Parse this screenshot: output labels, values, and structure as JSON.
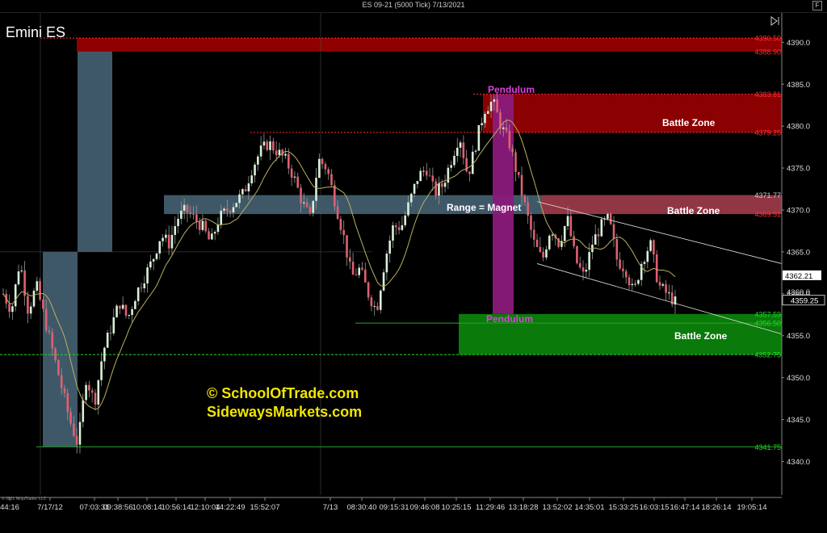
{
  "window": {
    "title": "ES 09-21 (5000 Tick)  7/13/2021",
    "button": "F"
  },
  "colors": {
    "bull": "#d8f0d8",
    "bear": "#e06070",
    "wick": "#999999",
    "ma": "#b8b060",
    "bg": "#000000",
    "resistance": "#8b0000",
    "support": "#0a7a0a",
    "magnet": "#3f5868",
    "pendulum": "#8a1a7a",
    "watermark": "#f2e600"
  },
  "chart_data": {
    "type": "candlestick",
    "title": "Emini ES",
    "ylim": [
      4336.0,
      4393.5
    ],
    "y_ticks": [
      4340.0,
      4345.0,
      4350.0,
      4355.0,
      4360.0,
      4365.0,
      4370.0,
      4375.0,
      4380.0,
      4385.0,
      4390.0
    ],
    "x_tick_labels": [
      "44:16",
      "7/17/12",
      "07:03:31",
      "09:38:56",
      "10:08:14",
      "10:56:14",
      "12:10:04",
      "14:22:49",
      "15:52:07",
      "7/13",
      "08:30:40",
      "09:15:31",
      "09:46:08",
      "10:25:15",
      "11:29:46",
      "13:18:28",
      "13:52:02",
      "14:35:01",
      "15:33:25",
      "16:03:15",
      "16:47:14",
      "18:26:14",
      "19:05:14"
    ],
    "price_levels": [
      {
        "value": 4390.5,
        "label": "4390.50",
        "color": "#ff3030"
      },
      {
        "value": 4388.9,
        "label": "4388.90",
        "color": "#ff3030"
      },
      {
        "value": 4383.81,
        "label": "4383.81",
        "color": "#ff3030"
      },
      {
        "value": 4379.25,
        "label": "4379.25",
        "color": "#ff3030"
      },
      {
        "value": 4371.77,
        "label": "4371.77",
        "color": "#cccccc"
      },
      {
        "value": 4369.51,
        "label": "4369.51",
        "color": "#ff3030"
      },
      {
        "value": 4357.59,
        "label": "4357.59",
        "color": "#22dd22"
      },
      {
        "value": 4356.5,
        "label": "4356.50",
        "color": "#22dd22"
      },
      {
        "value": 4352.75,
        "label": "4352.75",
        "color": "#22dd22"
      },
      {
        "value": 4341.75,
        "label": "4341.75",
        "color": "#22dd22"
      }
    ],
    "price_markers": [
      {
        "value": 4362.21,
        "label": "4362.21",
        "style": "black-on-white"
      },
      {
        "value": 4360.0,
        "label": "4360.0",
        "style": "partial"
      },
      {
        "value": 4359.25,
        "label": "4359.25",
        "style": "white-on-black"
      }
    ],
    "annotations": {
      "battle_zone_top": "Battle Zone",
      "battle_zone_mid": "Battle Zone",
      "battle_zone_bottom": "Battle Zone",
      "range_magnet": "Range = Magnet",
      "pendulum_top": "Pendulum",
      "pendulum_bottom": "Pendulum",
      "watermark_line1": "© SchoolOfTrade.com",
      "watermark_line2": "SidewaysMarkets.com",
      "copyright": "© 2021 NinjaTrader, LLC"
    },
    "anchors": [
      [
        0,
        4360
      ],
      [
        6,
        4358
      ],
      [
        12,
        4364
      ],
      [
        18,
        4358
      ],
      [
        24,
        4361
      ],
      [
        30,
        4357
      ],
      [
        36,
        4353
      ],
      [
        42,
        4349
      ],
      [
        48,
        4345
      ],
      [
        54,
        4342
      ],
      [
        60,
        4350
      ],
      [
        66,
        4347
      ],
      [
        72,
        4353
      ],
      [
        78,
        4356
      ],
      [
        84,
        4359
      ],
      [
        90,
        4357
      ],
      [
        96,
        4360
      ],
      [
        102,
        4362
      ],
      [
        108,
        4364
      ],
      [
        114,
        4367
      ],
      [
        120,
        4366
      ],
      [
        126,
        4369
      ],
      [
        132,
        4370
      ],
      [
        138,
        4369
      ],
      [
        144,
        4368
      ],
      [
        150,
        4366
      ],
      [
        156,
        4369
      ],
      [
        162,
        4370
      ],
      [
        168,
        4371
      ],
      [
        174,
        4372
      ],
      [
        180,
        4375
      ],
      [
        186,
        4377
      ],
      [
        192,
        4378
      ],
      [
        198,
        4377
      ],
      [
        204,
        4376
      ],
      [
        210,
        4374
      ],
      [
        216,
        4371
      ],
      [
        222,
        4369
      ],
      [
        228,
        4376
      ],
      [
        234,
        4375
      ],
      [
        240,
        4371
      ],
      [
        246,
        4367
      ],
      [
        252,
        4362
      ],
      [
        258,
        4363
      ],
      [
        264,
        4360
      ],
      [
        270,
        4358
      ],
      [
        276,
        4364
      ],
      [
        282,
        4368
      ],
      [
        288,
        4368
      ],
      [
        294,
        4371
      ],
      [
        300,
        4374
      ],
      [
        306,
        4375
      ],
      [
        312,
        4372
      ],
      [
        318,
        4373
      ],
      [
        324,
        4376
      ],
      [
        330,
        4379
      ],
      [
        336,
        4374
      ],
      [
        342,
        4378
      ],
      [
        348,
        4382
      ],
      [
        354,
        4383
      ],
      [
        360,
        4380
      ],
      [
        366,
        4378
      ],
      [
        372,
        4374
      ],
      [
        378,
        4370
      ],
      [
        384,
        4366
      ],
      [
        390,
        4364
      ],
      [
        396,
        4368
      ],
      [
        402,
        4366
      ],
      [
        408,
        4369
      ],
      [
        414,
        4364
      ],
      [
        420,
        4362
      ],
      [
        426,
        4366
      ],
      [
        432,
        4368
      ],
      [
        438,
        4369
      ],
      [
        444,
        4364
      ],
      [
        450,
        4363
      ],
      [
        456,
        4360
      ],
      [
        462,
        4364
      ],
      [
        468,
        4366
      ],
      [
        474,
        4361
      ],
      [
        480,
        4360
      ],
      [
        486,
        4359
      ]
    ]
  }
}
